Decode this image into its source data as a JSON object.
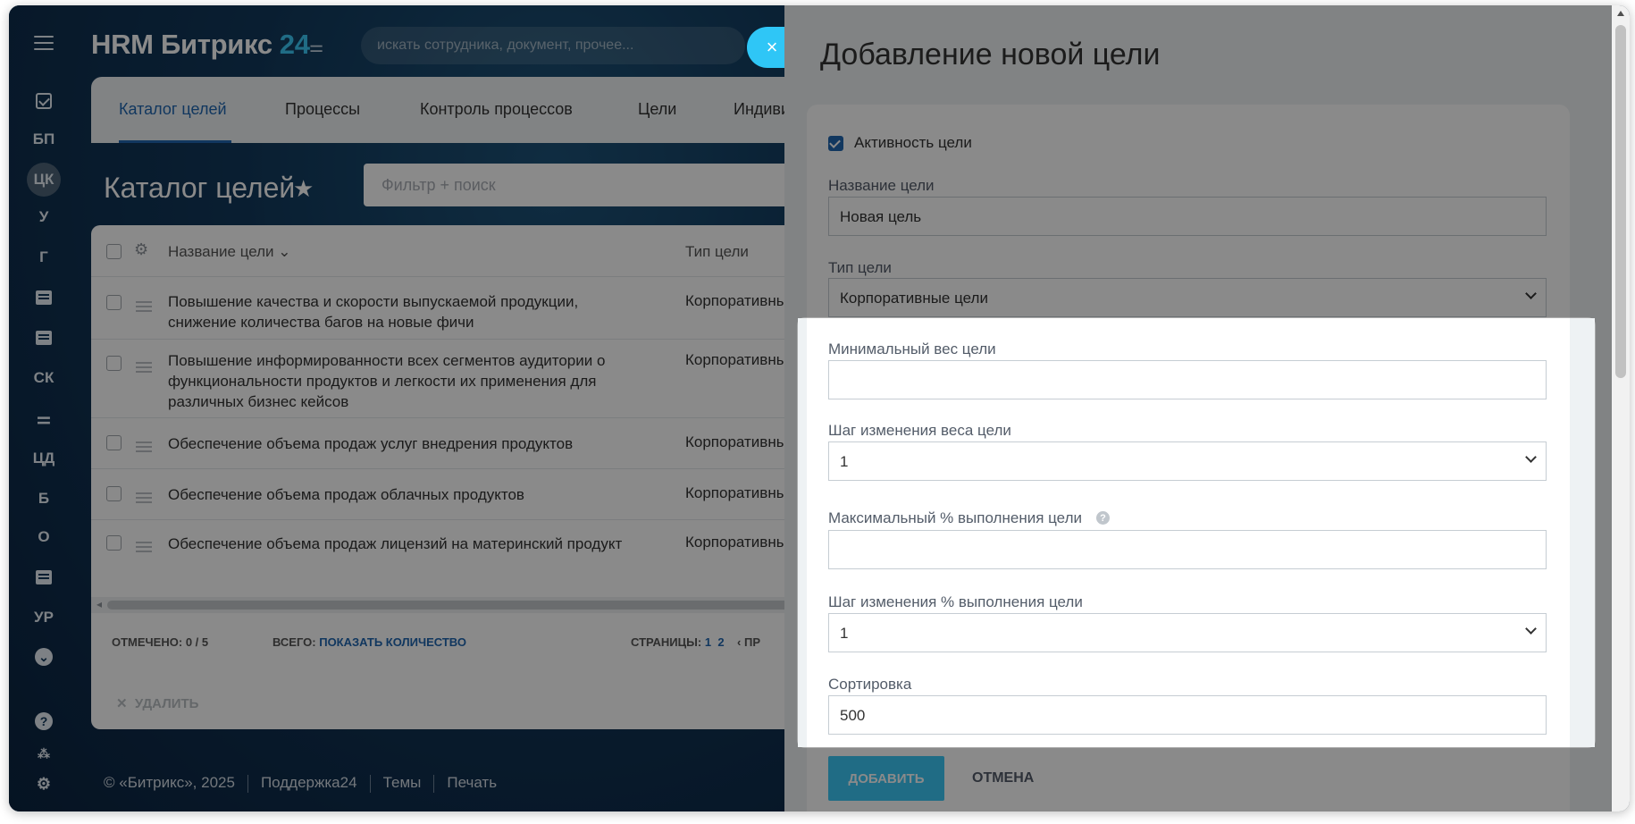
{
  "app": {
    "brand_prefix": "HRM Битрикс",
    "brand_num": "24",
    "search_placeholder": "искать сотрудника, документ, прочее...",
    "close_label": "×"
  },
  "sidebar": {
    "items": [
      "БП",
      "ЦК",
      "У",
      "Г",
      "СК",
      "ЦД",
      "Б",
      "О",
      "УР"
    ]
  },
  "tabs": [
    "Каталог целей",
    "Процессы",
    "Контроль процессов",
    "Цели",
    "Индиви"
  ],
  "page": {
    "title": "Каталог целей",
    "filter_placeholder": "Фильтр + поиск"
  },
  "grid": {
    "col_name": "Название цели",
    "col_type": "Тип цели",
    "rows": [
      {
        "name": "Повышение качества и скорости выпускаемой продукции, снижение количества багов на новые фичи",
        "type": "Корпоративные"
      },
      {
        "name": "Повышение информированности всех сегментов аудитории о функциональности продуктов и легкости их применения для различных бизнес кейсов",
        "type": "Корпоративные"
      },
      {
        "name": "Обеспечение объема продаж услуг внедрения продуктов",
        "type": "Корпоративные"
      },
      {
        "name": "Обеспечение объема продаж облачных продуктов",
        "type": "Корпоративные"
      },
      {
        "name": "Обеспечение объема продаж лицензий на материнский продукт",
        "type": "Корпоративные"
      }
    ],
    "selected_label": "ОТМЕЧЕНО:",
    "selected_value": "0 / 5",
    "total_label": "ВСЕГО:",
    "total_link": "ПОКАЗАТЬ КОЛИЧЕСТВО",
    "pages_label": "СТРАНИЦЫ:",
    "page1": "1",
    "page2": "2",
    "prev": "ПР",
    "delete": "УДАЛИТЬ"
  },
  "footer": {
    "copyright": "© «Битрикс», 2025",
    "support": "Поддержка24",
    "themes": "Темы",
    "print": "Печать"
  },
  "panel": {
    "title": "Добавление новой цели",
    "active_label": "Активность цели",
    "name_label": "Название цели",
    "name_value": "Новая цель",
    "type_label": "Тип цели",
    "type_value": "Корпоративные цели",
    "min_weight_label": "Минимальный вес цели",
    "min_weight_value": "",
    "weight_step_label": "Шаг изменения веса цели",
    "weight_step_value": "1",
    "max_pct_label": "Максимальный % выполнения цели",
    "max_pct_value": "",
    "pct_step_label": "Шаг изменения % выполнения цели",
    "pct_step_value": "1",
    "sort_label": "Сортировка",
    "sort_value": "500",
    "add_button": "ДОБАВИТЬ",
    "cancel_button": "ОТМЕНА"
  }
}
